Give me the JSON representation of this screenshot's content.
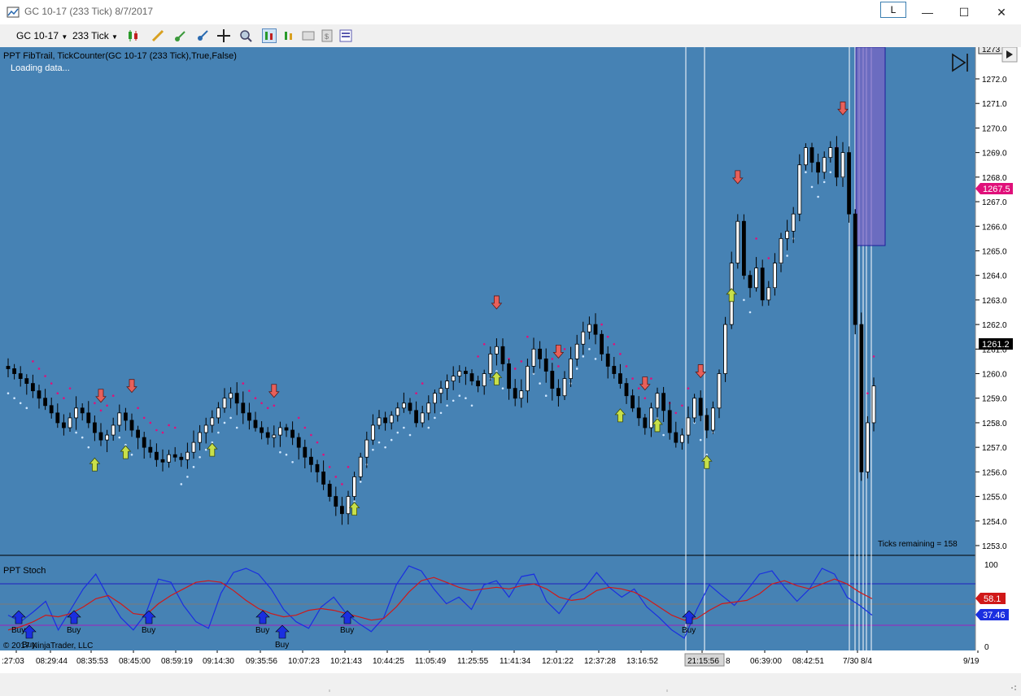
{
  "window": {
    "title": "GC 10-17 (233 Tick)  8/7/2017",
    "layout_button": "L"
  },
  "toolbar": {
    "instrument": "GC 10-17",
    "interval": "233 Tick"
  },
  "price_panel": {
    "indicator_label": "PPT FibTrail, TickCounter(GC 10-17 (233 Tick),True,False)",
    "status": "Loading data...",
    "ticks_remaining": "Ticks remaining = 158",
    "last_price_label": "1267.5",
    "crosshair_price_label": "1261.2",
    "top_partial_label": "1273",
    "accent_pink": "#e0107a",
    "background": "#4682b4"
  },
  "stoch_panel": {
    "label": "PPT  Stoch",
    "copyright": "© 2017 NinjaTrader, LLC",
    "value_red": "58.1",
    "value_blue": "37.46",
    "buy_label": "Buy"
  },
  "time_axis": {
    "labels": [
      ":27:03",
      "08:29:44",
      "08:35:53",
      "08:45:00",
      "08:59:19",
      "09:14:30",
      "09:35:56",
      "10:07:23",
      "10:21:43",
      "10:44:25",
      "11:05:49",
      "11:25:55",
      "11:41:34",
      "12:01:22",
      "12:37:28",
      "13:16:52",
      "21:15:56",
      "06:39:00",
      "08:42:51",
      "7/30",
      "9/19"
    ],
    "cursor_label": "21:15:56",
    "partial_labels": [
      "8",
      "8/4"
    ]
  },
  "chart_data": [
    {
      "type": "candlestick",
      "yaxis_ticks": [
        1253,
        1254,
        1255,
        1256,
        1257,
        1258,
        1259,
        1260,
        1261,
        1262,
        1263,
        1264,
        1265,
        1266,
        1267,
        1268,
        1269,
        1270,
        1271,
        1272
      ],
      "ylim": [
        1252.6,
        1273.1
      ],
      "close_series": [
        1260.2,
        1260.0,
        1259.8,
        1259.6,
        1259.3,
        1259.0,
        1258.7,
        1258.4,
        1258.0,
        1257.8,
        1258.2,
        1258.6,
        1258.4,
        1258.0,
        1257.6,
        1257.3,
        1257.5,
        1257.9,
        1258.4,
        1258.1,
        1257.7,
        1257.4,
        1257.0,
        1256.8,
        1256.5,
        1256.4,
        1256.7,
        1256.6,
        1256.5,
        1256.8,
        1257.2,
        1257.6,
        1257.9,
        1258.2,
        1258.6,
        1259.0,
        1259.2,
        1258.8,
        1258.4,
        1258.1,
        1257.8,
        1257.6,
        1257.4,
        1257.5,
        1257.8,
        1257.7,
        1257.4,
        1257.0,
        1256.6,
        1256.3,
        1256.0,
        1255.5,
        1255.0,
        1254.6,
        1254.3,
        1255.0,
        1255.8,
        1256.6,
        1257.3,
        1257.9,
        1258.2,
        1258.0,
        1258.3,
        1258.6,
        1258.8,
        1258.5,
        1258.0,
        1258.4,
        1258.8,
        1259.2,
        1259.4,
        1259.7,
        1259.9,
        1260.1,
        1260.0,
        1259.7,
        1259.5,
        1260.0,
        1260.8,
        1261.1,
        1260.4,
        1259.4,
        1259.0,
        1259.3,
        1260.3,
        1261.0,
        1260.6,
        1260.1,
        1259.4,
        1259.1,
        1259.8,
        1260.6,
        1261.2,
        1261.7,
        1262.0,
        1261.6,
        1260.8,
        1260.3,
        1260.0,
        1259.6,
        1259.1,
        1258.6,
        1258.2,
        1257.8,
        1258.6,
        1259.2,
        1258.5,
        1257.6,
        1257.2,
        1257.5,
        1258.2,
        1259.0,
        1258.3,
        1257.7,
        1258.6,
        1260.0,
        1262.0,
        1264.5,
        1266.2,
        1264.0,
        1263.5,
        1264.3,
        1263.0,
        1263.5,
        1264.5,
        1265.5,
        1265.8,
        1266.5,
        1268.5,
        1269.2,
        1268.6,
        1268.2,
        1268.8,
        1269.2,
        1268.0,
        1269.0,
        1266.5,
        1262.0,
        1256.0,
        1258.0,
        1259.5
      ]
    },
    {
      "type": "line",
      "series": [
        {
          "name": "",
          "color": "#1a2fe0",
          "values": [
            38,
            30,
            42,
            55,
            20,
            45,
            70,
            88,
            60,
            35,
            20,
            40,
            82,
            78,
            50,
            30,
            22,
            65,
            90,
            95,
            88,
            70,
            45,
            30,
            22,
            48,
            60,
            40,
            28,
            18,
            35,
            75,
            98,
            92,
            70,
            52,
            60,
            45,
            75,
            80,
            60,
            85,
            88,
            55,
            40,
            62,
            70,
            90,
            72,
            60,
            70,
            48,
            35,
            20,
            10,
            45,
            75,
            62,
            50,
            68,
            88,
            92,
            72,
            55,
            70,
            95,
            88,
            60,
            50,
            38
          ]
        },
        {
          "name": "",
          "color": "#d01818",
          "values": [
            20,
            24,
            30,
            38,
            36,
            40,
            48,
            58,
            62,
            52,
            40,
            38,
            52,
            62,
            70,
            78,
            80,
            78,
            68,
            56,
            46,
            40,
            36,
            38,
            44,
            46,
            44,
            40,
            36,
            32,
            34,
            48,
            66,
            80,
            84,
            78,
            72,
            68,
            70,
            72,
            70,
            74,
            76,
            70,
            60,
            56,
            58,
            68,
            72,
            70,
            66,
            58,
            48,
            38,
            32,
            34,
            44,
            52,
            54,
            56,
            64,
            76,
            80,
            74,
            70,
            76,
            82,
            76,
            66,
            58
          ]
        }
      ],
      "yaxis_ticks": [
        0,
        100
      ],
      "ylim": [
        0,
        100
      ],
      "reference_lines": [
        20,
        50,
        80
      ]
    }
  ]
}
